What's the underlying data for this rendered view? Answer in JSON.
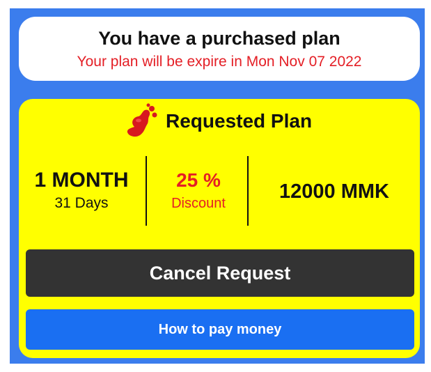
{
  "purchased": {
    "title": "You have a purchased plan",
    "subtitle": "Your plan will be expire in Mon Nov 07 2022"
  },
  "plan": {
    "header": "Requested Plan",
    "logo_icon": "red-blob-logo-icon",
    "duration_main": "1 MONTH",
    "duration_sub": "31 Days",
    "discount_main": "25 %",
    "discount_sub": "Discount",
    "price": "12000 MMK"
  },
  "actions": {
    "cancel_label": "Cancel Request",
    "pay_label": "How to pay money"
  },
  "colors": {
    "frame": "#3b7ded",
    "card": "#ffff00",
    "accent_red": "#e41e25",
    "cancel_bg": "#333333",
    "pay_bg": "#1a6ff2"
  }
}
